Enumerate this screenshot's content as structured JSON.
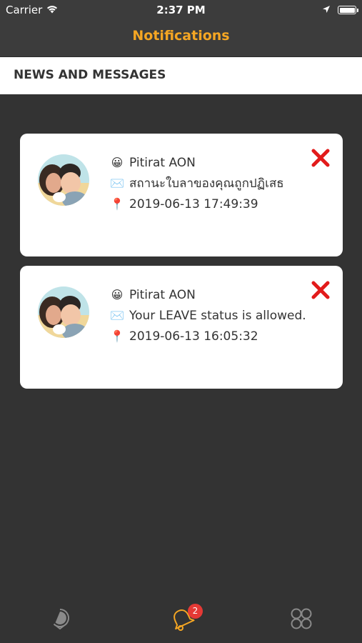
{
  "status_bar": {
    "carrier": "Carrier",
    "time": "2:37 PM"
  },
  "nav": {
    "title": "Notifications",
    "title_color": "#f5a623"
  },
  "section": {
    "title": "NEWS AND MESSAGES"
  },
  "notifications": [
    {
      "name": "Pitirat AON",
      "message": "สถานะใบลาของคุณถูกปฏิเสธ",
      "datetime": "2019-06-13 17:49:39",
      "name_icon": "grinning-face-icon",
      "message_icon": "envelope-icon",
      "datetime_icon": "pin-icon"
    },
    {
      "name": "Pitirat AON",
      "message": "Your LEAVE status is allowed.",
      "datetime": "2019-06-13 16:05:32",
      "name_icon": "grinning-face-icon",
      "message_icon": "envelope-icon",
      "datetime_icon": "pin-icon"
    }
  ],
  "tab_bar": {
    "notifications_badge": "2",
    "active_color": "#f5a623",
    "badge_color": "#e53935"
  }
}
